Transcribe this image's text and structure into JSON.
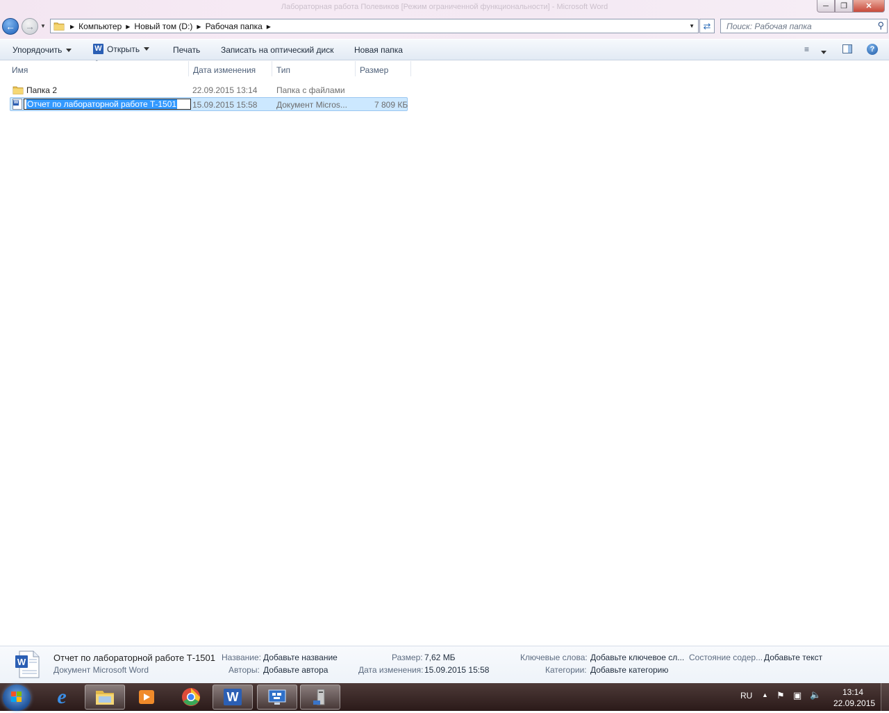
{
  "window": {
    "ghost_title": "Лабораторная работа Полевиков [Режим ограниченной функциональности] - Microsoft Word",
    "min_icon": "minimize-icon",
    "max_icon": "restore-icon",
    "close_icon": "close-icon"
  },
  "address": {
    "breadcrumbs": [
      "Компьютер",
      "Новый том (D:)",
      "Рабочая папка"
    ]
  },
  "search": {
    "placeholder": "Поиск: Рабочая папка"
  },
  "toolbar": {
    "organize": "Упорядочить",
    "open": "Открыть",
    "print": "Печать",
    "burn": "Записать на оптический диск",
    "new_folder": "Новая папка"
  },
  "columns": {
    "name": "Имя",
    "date": "Дата изменения",
    "type": "Тип",
    "size": "Размер"
  },
  "files": [
    {
      "name": "Папка 2",
      "date": "22.09.2015 13:14",
      "type": "Папка с файлами",
      "size": "",
      "icon": "folder-icon"
    },
    {
      "name": "Отчет по лабораторной работе Т-1501",
      "date": "15.09.2015 15:58",
      "type": "Документ Micros...",
      "size": "7 809 КБ",
      "icon": "word-document-icon",
      "selected": true,
      "renaming": true
    }
  ],
  "details": {
    "file_name": "Отчет по лабораторной работе Т-1501",
    "file_type": "Документ Microsoft Word",
    "title_label": "Название:",
    "title_value": "Добавьте название",
    "authors_label": "Авторы:",
    "authors_value": "Добавьте автора",
    "size_label": "Размер:",
    "size_value": "7,62 МБ",
    "modified_label": "Дата изменения:",
    "modified_value": "15.09.2015 15:58",
    "keywords_label": "Ключевые слова:",
    "keywords_value": "Добавьте ключевое сл...",
    "content_status_label": "Состояние содер...",
    "content_status_value": "Добавьте текст",
    "categories_label": "Категории:",
    "categories_value": "Добавьте категорию"
  },
  "taskbar": {
    "language": "RU",
    "time": "13:14",
    "date": "22.09.2015"
  }
}
